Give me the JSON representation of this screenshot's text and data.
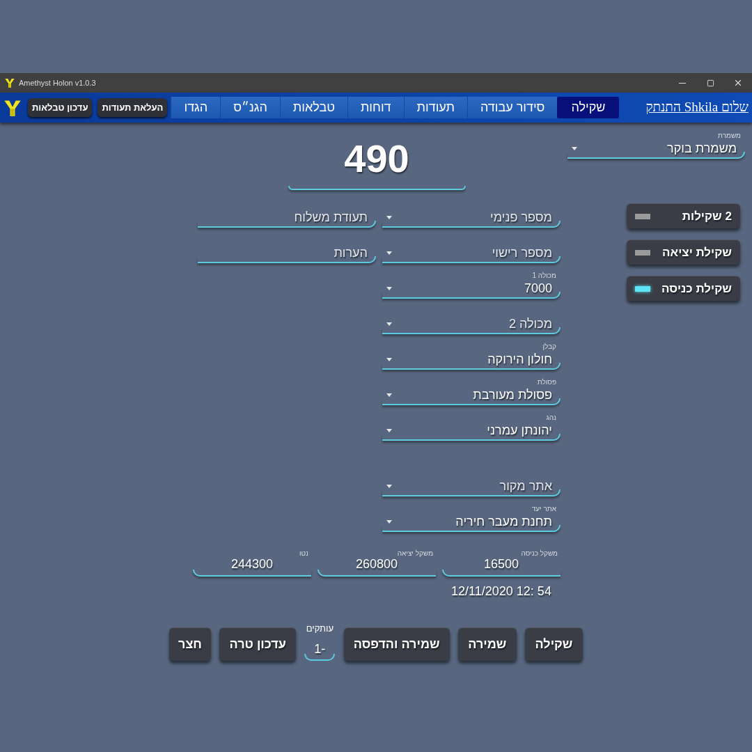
{
  "window": {
    "title": "Amethyst Holon v1.0.3"
  },
  "user_link": "שלום Shkila התנתק",
  "tabs": [
    {
      "label": "שקילה",
      "selected": true
    },
    {
      "label": "סידור עבודה",
      "selected": false
    },
    {
      "label": "תעודות",
      "selected": false
    },
    {
      "label": "דוחות",
      "selected": false
    },
    {
      "label": "טבלאות",
      "selected": false
    },
    {
      "label": "הגנ״ס",
      "selected": false
    },
    {
      "label": "הגדו",
      "selected": false
    }
  ],
  "toolbar_buttons": [
    "העלאת תעודות",
    "עדכון טבלאות"
  ],
  "shift": {
    "label": "משמרת",
    "value": "משמרת בוקר"
  },
  "weight_display": "490",
  "modes": [
    {
      "label": "2 שקילות",
      "on": false
    },
    {
      "label": "שקילת יציאה",
      "on": false
    },
    {
      "label": "שקילת כניסה",
      "on": true
    }
  ],
  "load_fields": [
    {
      "kind": "dropdown",
      "placeholder": "מספר פנימי"
    },
    {
      "kind": "dropdown",
      "placeholder": "מספר רישוי"
    },
    {
      "kind": "dropdown",
      "label": "מכולה 1",
      "value": "7000"
    },
    {
      "kind": "dropdown",
      "placeholder": "מכולה 2"
    },
    {
      "kind": "dropdown",
      "label": "קבלן",
      "value": "חולון הירוקה"
    },
    {
      "kind": "dropdown",
      "label": "פסולת",
      "value": "פסולת מעורבת"
    },
    {
      "kind": "dropdown",
      "label": "נהג",
      "value": "יהונתן עמרני"
    }
  ],
  "site_fields": [
    {
      "kind": "dropdown",
      "placeholder": "אתר מקור"
    },
    {
      "kind": "dropdown",
      "label": "אתר יעד",
      "value": "תחנת מעבר  חיריה"
    }
  ],
  "note_fields": [
    {
      "kind": "text",
      "placeholder": "תעודת משלוח"
    },
    {
      "kind": "text",
      "placeholder": "הערות"
    }
  ],
  "weights": [
    {
      "label": "משקל כניסה",
      "value": "16500"
    },
    {
      "label": "משקל יציאה",
      "value": "260800"
    },
    {
      "label": "נטו",
      "value": "244300"
    }
  ],
  "timestamp": "12/11/2020 12: 54",
  "actions": [
    {
      "kind": "button",
      "label": "שקילה"
    },
    {
      "kind": "button",
      "label": "שמירה"
    },
    {
      "kind": "button",
      "label": "שמירה והדפסה"
    },
    {
      "kind": "copies",
      "label": "עותקים",
      "value": "1-"
    },
    {
      "kind": "button",
      "label": "עדכון טרה"
    },
    {
      "kind": "button",
      "label": "חצר"
    }
  ]
}
